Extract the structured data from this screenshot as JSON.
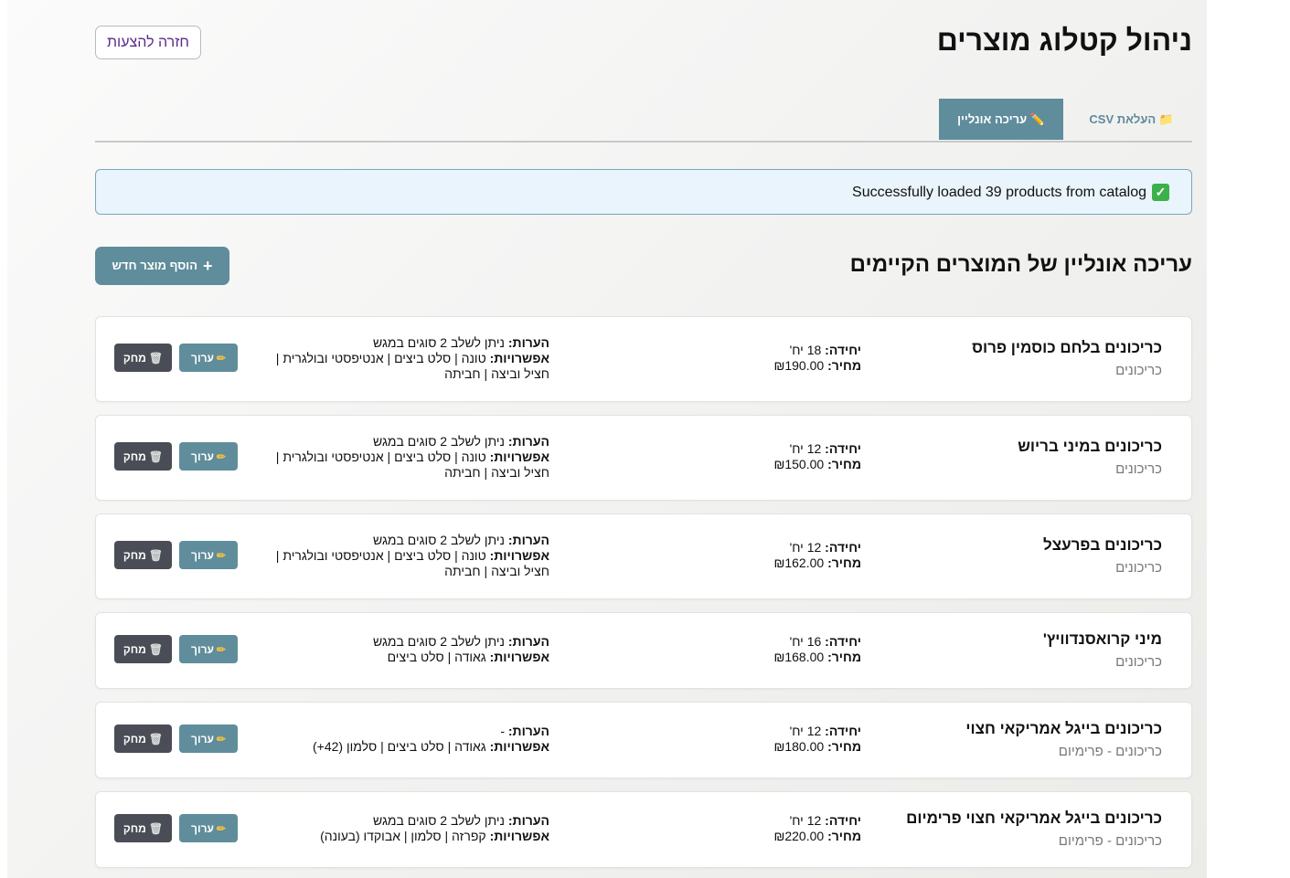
{
  "header": {
    "title": "ניהול קטלוג מוצרים",
    "back_button": "חזרה להצעות"
  },
  "tabs": [
    {
      "icon": "folder-icon",
      "label": "📁 העלאת CSV",
      "active": false
    },
    {
      "icon": "pencil-icon",
      "label": "✏️ עריכה אונליין",
      "active": true
    }
  ],
  "alert": {
    "icon": "✅",
    "message": "Successfully loaded 39 products from catalog"
  },
  "section": {
    "title": "עריכה אונליין של המוצרים הקיימים",
    "add_button": "הוסף מוצר חדש",
    "add_icon": "+"
  },
  "labels": {
    "unit": "יחידה:",
    "price": "מחיר:",
    "notes": "הערות:",
    "options": "אפשרויות:",
    "edit": "ערוך",
    "delete": "מחק"
  },
  "products": [
    {
      "name": "כריכונים בלחם כוסמין פרוס",
      "category": "כריכונים",
      "unit": "18 יח'",
      "price": "₪190.00",
      "notes": "ניתן לשלב 2 סוגים במגש",
      "options": "טונה | סלט ביצים | אנטיפסטי ובולגרית | חציל וביצה | חביתה"
    },
    {
      "name": "כריכונים במיני בריוש",
      "category": "כריכונים",
      "unit": "12 יח'",
      "price": "₪150.00",
      "notes": "ניתן לשלב 2 סוגים במגש",
      "options": "טונה | סלט ביצים | אנטיפסטי ובולגרית | חציל וביצה | חביתה"
    },
    {
      "name": "כריכונים בפרעצל",
      "category": "כריכונים",
      "unit": "12 יח'",
      "price": "₪162.00",
      "notes": "ניתן לשלב 2 סוגים במגש",
      "options": "טונה | סלט ביצים | אנטיפסטי ובולגרית | חציל וביצה | חביתה"
    },
    {
      "name": "מיני קרואסנדוויץ'",
      "category": "כריכונים",
      "unit": "16 יח'",
      "price": "₪168.00",
      "notes": "ניתן לשלב 2 סוגים במגש",
      "options": "גאודה | סלט ביצים"
    },
    {
      "name": "כריכונים בייגל אמריקאי חצוי",
      "category": "כריכונים - פרימיום",
      "unit": "12 יח'",
      "price": "₪180.00",
      "notes": "-",
      "options": "גאודה | סלט ביצים | סלמון (42+)"
    },
    {
      "name": "כריכונים בייגל אמריקאי חצוי פרימיום",
      "category": "כריכונים - פרימיום",
      "unit": "12 יח'",
      "price": "₪220.00",
      "notes": "ניתן לשלב 2 סוגים במגש",
      "options": "קפרזה | סלמון | אבוקדו (בעונה)"
    }
  ]
}
